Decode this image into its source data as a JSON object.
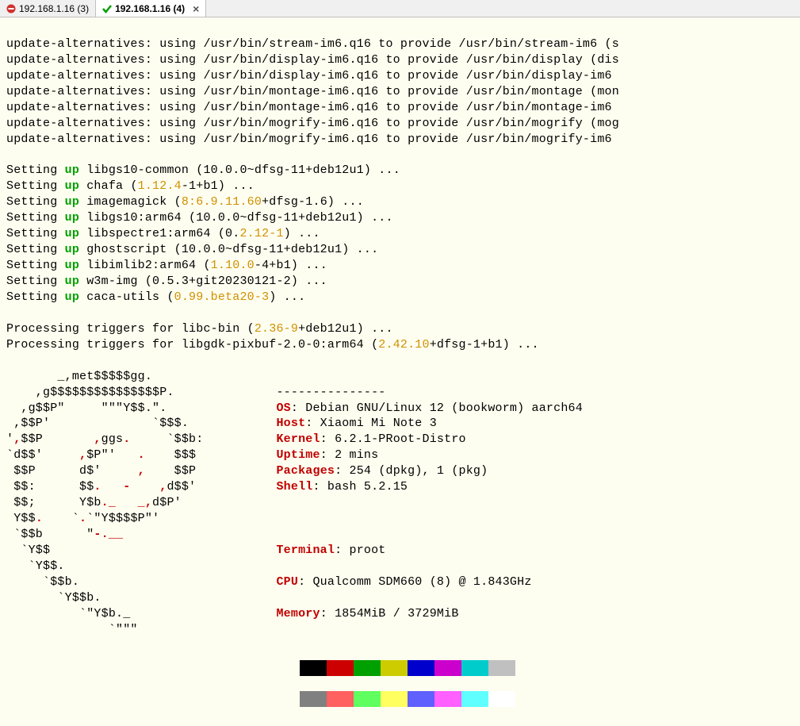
{
  "tabs": [
    {
      "label": "192.168.1.16 (3)",
      "status": "error"
    },
    {
      "label": "192.168.1.16 (4)",
      "status": "ok",
      "active": true
    }
  ],
  "apt_lines": [
    "update-alternatives: using /usr/bin/stream-im6.q16 to provide /usr/bin/stream-im6 (s",
    "update-alternatives: using /usr/bin/display-im6.q16 to provide /usr/bin/display (dis",
    "update-alternatives: using /usr/bin/display-im6.q16 to provide /usr/bin/display-im6 ",
    "update-alternatives: using /usr/bin/montage-im6.q16 to provide /usr/bin/montage (mon",
    "update-alternatives: using /usr/bin/montage-im6.q16 to provide /usr/bin/montage-im6 ",
    "update-alternatives: using /usr/bin/mogrify-im6.q16 to provide /usr/bin/mogrify (mog",
    "update-alternatives: using /usr/bin/mogrify-im6.q16 to provide /usr/bin/mogrify-im6 "
  ],
  "setup": [
    {
      "pre": "Setting ",
      "up": "up",
      "post1": " libgs10-common (10.0.0~dfsg-11+deb12u1) ..."
    },
    {
      "pre": "Setting ",
      "up": "up",
      "post1": " chafa (",
      "ver": "1.12.4",
      "post2": "-1+b1) ..."
    },
    {
      "pre": "Setting ",
      "up": "up",
      "post1": " imagemagick (",
      "ver": "8:6.9.11.60",
      "post2": "+dfsg-1.6) ..."
    },
    {
      "pre": "Setting ",
      "up": "up",
      "post1": " libgs10:arm64 (10.0.0~dfsg-11+deb12u1) ..."
    },
    {
      "pre": "Setting ",
      "up": "up",
      "post1": " libspectre1:arm64 (0.",
      "ver": "2.12-1",
      "post2": ") ..."
    },
    {
      "pre": "Setting ",
      "up": "up",
      "post1": " ghostscript (10.0.0~dfsg-11+deb12u1) ..."
    },
    {
      "pre": "Setting ",
      "up": "up",
      "post1": " libimlib2:arm64 (",
      "ver": "1.10.0",
      "post2": "-4+b1) ..."
    },
    {
      "pre": "Setting ",
      "up": "up",
      "post1": " w3m-img (0.5.3+git20230121-2) ..."
    },
    {
      "pre": "Setting ",
      "up": "up",
      "post1": " caca-utils (",
      "ver": "0.99.beta20-3",
      "post2": ") ..."
    }
  ],
  "triggers": [
    {
      "pre": "Processing triggers for libc-bin (",
      "ver": "2.36-9",
      "post": "+deb12u1) ..."
    },
    {
      "pre": "Processing triggers for libgdk-pixbuf-2.0-0:arm64 (",
      "ver": "2.42.10",
      "post": "+dfsg-1+b1) ..."
    }
  ],
  "logo": [
    "       _,met$$$$$gg.",
    "    ,g$$$$$$$$$$$$$$$P.",
    "  ,g$$P\"     \"\"\"Y$$.\".",
    " ,$$P'              `$$$.",
    "',$$P       ,ggs.     `$$b:",
    "`d$$'     ,$P\"'   .    $$$",
    " $$P      d$'     ,    $$P",
    " $$:      $$.   -    ,d$$'",
    " $$;      Y$b._   _,d$P'",
    " Y$$.    `.`\"Y$$$$P\"'",
    " `$$b      \"-.__",
    "  `Y$$",
    "   `Y$$.",
    "     `$$b.",
    "       `Y$$b.",
    "          `\"Y$b._",
    "              `\"\"\""
  ],
  "info": {
    "sep": "---------------",
    "os_label": "OS",
    "os": ": Debian GNU/Linux 12 (bookworm) aarch64",
    "host_label": "Host",
    "host": ": Xiaomi Mi Note 3",
    "kernel_label": "Kernel",
    "kernel": ": 6.2.1-PRoot-Distro",
    "uptime_label": "Uptime",
    "uptime": ": 2 mins",
    "packages_label": "Packages",
    "packages": ": 254 (dpkg), 1 (pkg)",
    "shell_label": "Shell",
    "shell": ": bash 5.2.15",
    "terminal_label": "Terminal",
    "terminal": ": proot",
    "cpu_label": "CPU",
    "cpu": ": Qualcomm SDM660 (8) @ 1.843GHz",
    "memory_label": "Memory",
    "memory": ": 1854MiB / 3729MiB"
  },
  "colors_dark": [
    "#000000",
    "#cc0000",
    "#00a000",
    "#cccc00",
    "#0000cc",
    "#cc00cc",
    "#00cccc",
    "#c0c0c0"
  ],
  "colors_light": [
    "#808080",
    "#ff6060",
    "#60ff60",
    "#ffff60",
    "#6060ff",
    "#ff60ff",
    "#60ffff",
    "#ffffff"
  ]
}
